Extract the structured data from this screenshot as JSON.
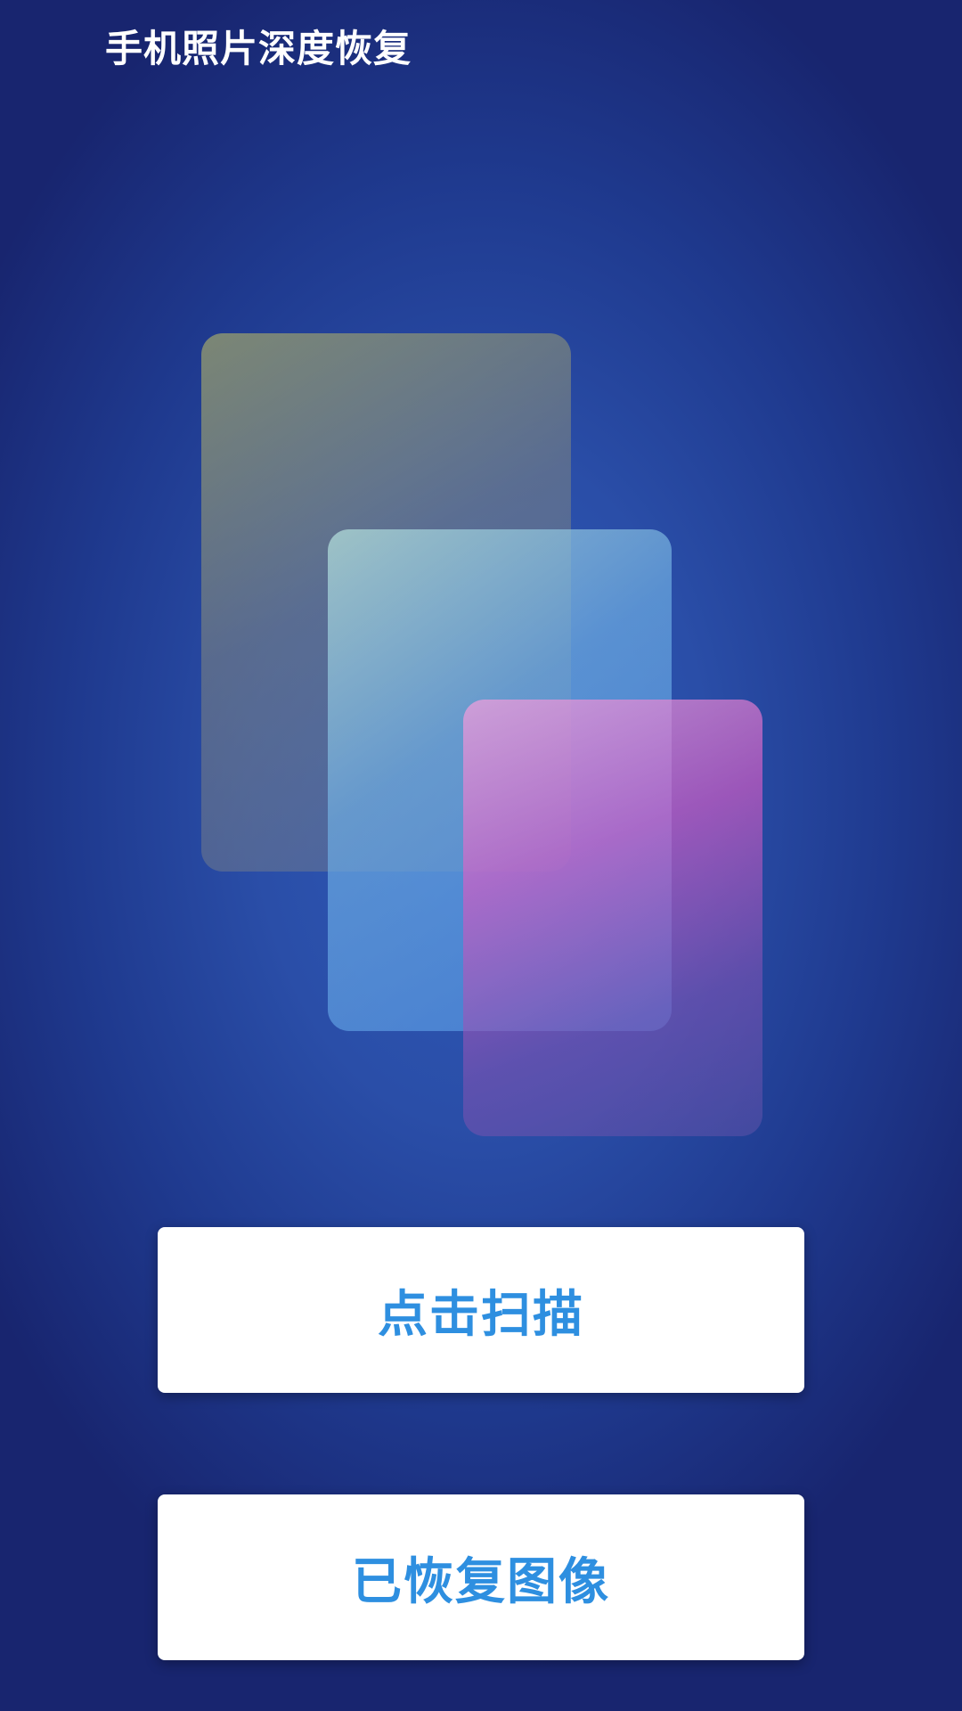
{
  "header": {
    "title": "手机照片深度恢复"
  },
  "illustration": {
    "cards": [
      {
        "name": "back",
        "color": "#9c9f6e"
      },
      {
        "name": "middle",
        "color": "#6fa8e0"
      },
      {
        "name": "front",
        "color": "#c25bb4"
      }
    ]
  },
  "actions": {
    "scan_label": "点击扫描",
    "recovered_label": "已恢复图像"
  },
  "colors": {
    "background": "#1f3a8f",
    "button_text": "#2e8fe0",
    "button_background": "#ffffff"
  }
}
